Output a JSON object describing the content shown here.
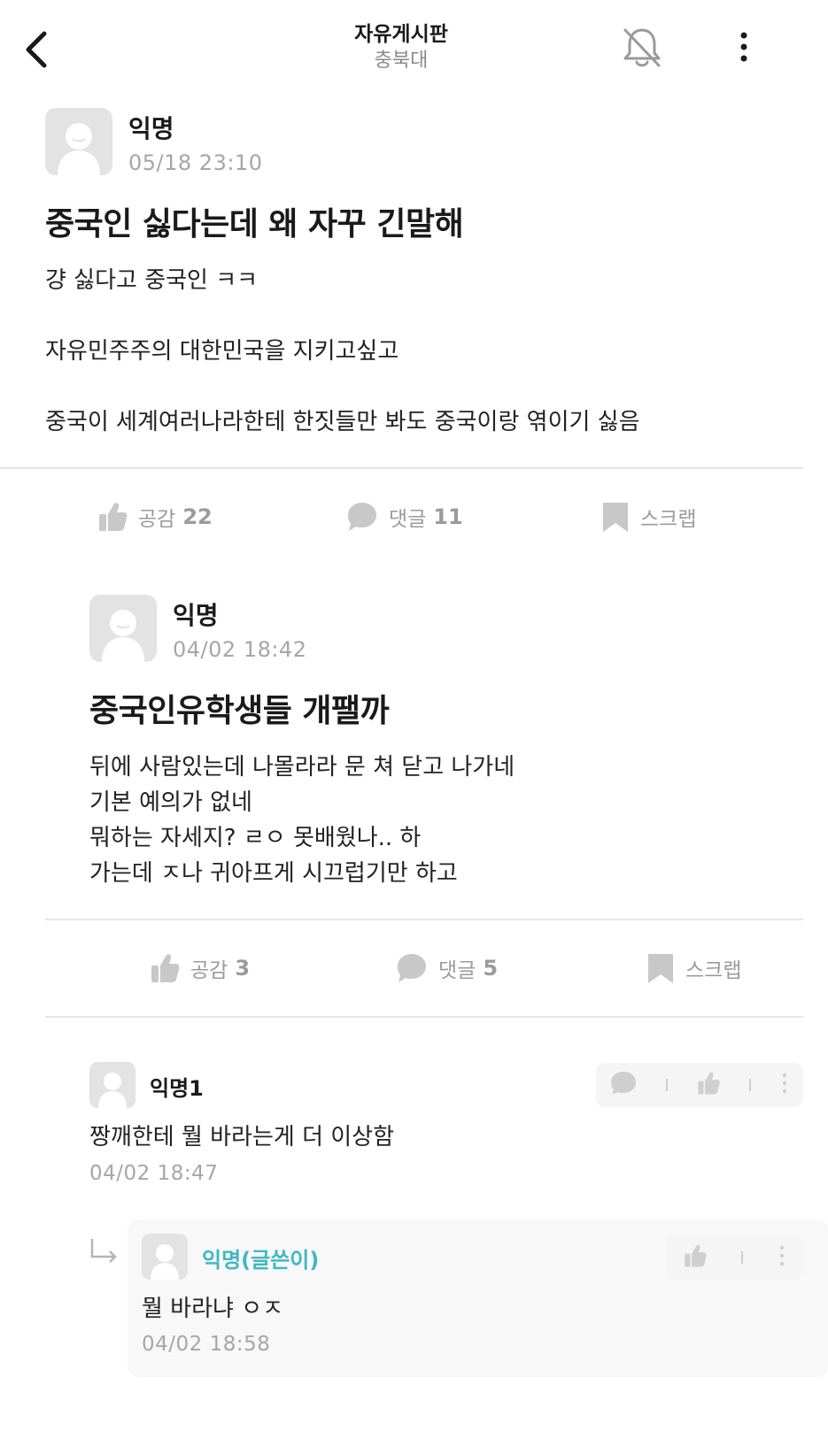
{
  "header": {
    "title": "자유게시판",
    "subtitle": "충북대"
  },
  "post": {
    "author": "익명",
    "date": "05/18 23:10",
    "title": "중국인 싫다는데 왜 자꾸 긴말해",
    "body": [
      "걍 싫다고 중국인 ㅋㅋ",
      "자유민주주의 대한민국을 지키고싶고",
      "중국이 세계여러나라한테 한짓들만 봐도 중국이랑 엮이기 싫음"
    ],
    "actions": {
      "like_label": "공감",
      "like_count": "22",
      "comment_label": "댓글",
      "comment_count": "11",
      "scrap_label": "스크랩"
    }
  },
  "quoted_post": {
    "author": "익명",
    "date": "04/02 18:42",
    "title": "중국인유학생들 개팰까",
    "body": [
      "뒤에 사람있는데 나몰라라 문 쳐 닫고 나가네",
      "기본 예의가 없네",
      "뭐하는 자세지? ㄹㅇ 못배웠나.. 하",
      "가는데 ㅈ나 귀아프게 시끄럽기만 하고"
    ],
    "actions": {
      "like_label": "공감",
      "like_count": "3",
      "comment_label": "댓글",
      "comment_count": "5",
      "scrap_label": "스크랩"
    }
  },
  "comments": [
    {
      "author": "익명1",
      "text": "짱깨한테 뭘 바라는게 더 이상함",
      "date": "04/02 18:47"
    }
  ],
  "replies": [
    {
      "author": "익명(글쓴이)",
      "text": "뭘 바라냐 ㅇㅈ",
      "date": "04/02 18:58"
    }
  ],
  "colors": {
    "author_accent": "#3fb8c3",
    "muted": "#9b9b9b",
    "divider": "#e6e6e6"
  },
  "icons": [
    "back-arrow-icon",
    "bell-off-icon",
    "more-vertical-icon",
    "thumbs-up-icon",
    "speech-bubble-icon",
    "bookmark-icon",
    "reply-arrow-icon"
  ]
}
